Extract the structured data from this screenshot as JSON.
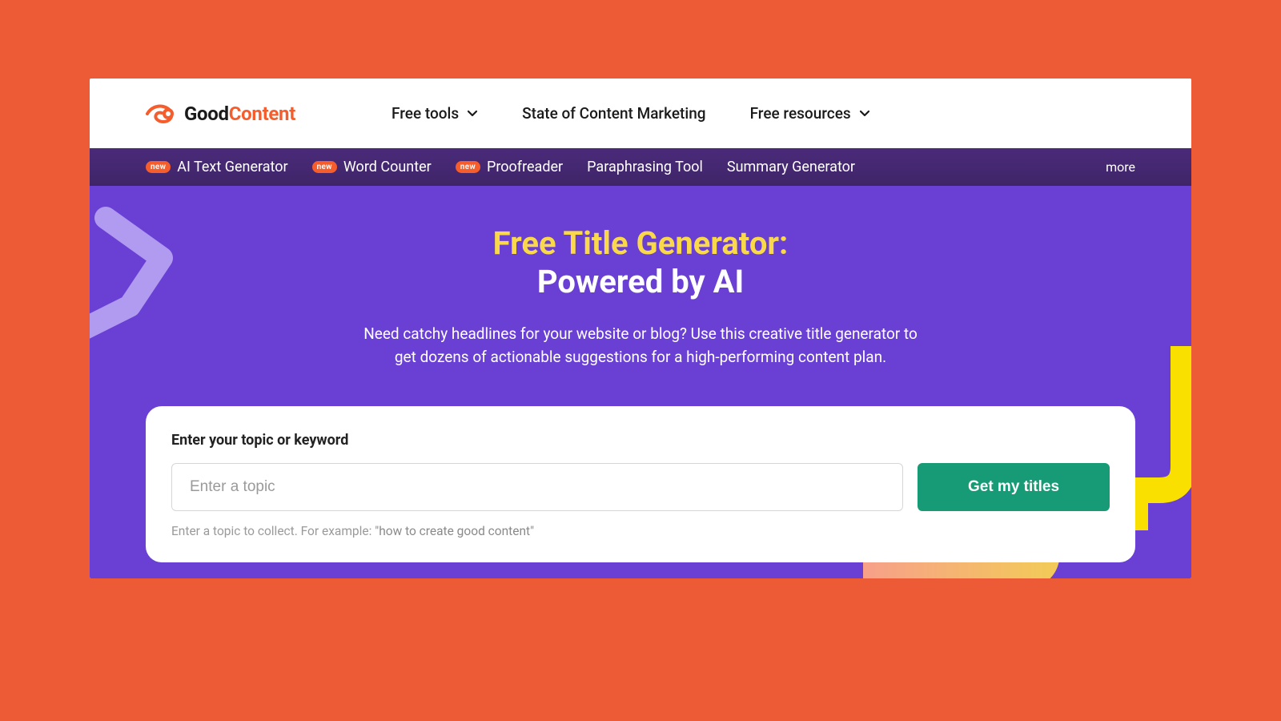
{
  "brand": {
    "good": "Good",
    "content": "Content"
  },
  "nav": {
    "items": [
      {
        "label": "Free tools",
        "dropdown": true
      },
      {
        "label": "State of Content Marketing",
        "dropdown": false
      },
      {
        "label": "Free resources",
        "dropdown": true
      }
    ]
  },
  "subnav": {
    "items": [
      {
        "label": "AI Text Generator",
        "badge": "new"
      },
      {
        "label": "Word Counter",
        "badge": "new"
      },
      {
        "label": "Proofreader",
        "badge": "new"
      },
      {
        "label": "Paraphrasing Tool",
        "badge": null
      },
      {
        "label": "Summary Generator",
        "badge": null
      }
    ],
    "more": "more"
  },
  "hero": {
    "title_line1": "Free Title Generator:",
    "title_line2": "Powered by AI",
    "description": "Need catchy headlines for your website or blog? Use this creative title generator to get dozens of actionable suggestions for a high-performing content plan."
  },
  "form": {
    "label": "Enter your topic or keyword",
    "placeholder": "Enter a topic",
    "button": "Get my titles",
    "hint_prefix": "Enter a topic to collect. For example: ",
    "hint_example": "\"how to create good content\""
  },
  "colors": {
    "frameBg": "#ed5a36",
    "purple": "#6a3fd4",
    "accent": "#f55d2c",
    "buttonGreen": "#169b76",
    "titleYellow": "#f9d94a"
  }
}
